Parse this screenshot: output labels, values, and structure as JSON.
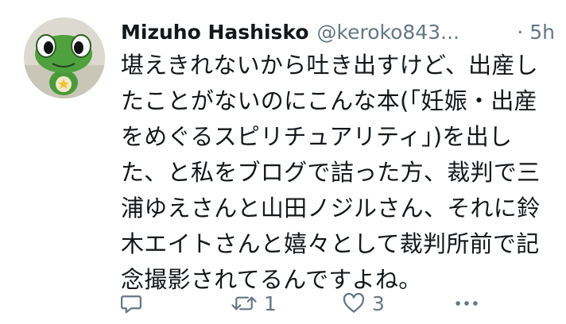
{
  "tweet": {
    "display_name": "Mizuho Hashisko",
    "handle": "@keroko843...",
    "timestamp": "· 5h",
    "text_lines": [
      "堪えきれないから吐き出すけど、出産し",
      "たことがないのにこんな本(「妊娠・出産",
      "をめぐるスピリチュアリティ」)を出し",
      "た、と私をブログで詰った方、裁判で三",
      "浦ゆえさんと山田ノジルさん、それに鈴",
      "木エイトさんと嬉々として裁判所前で記",
      "念撮影されてるんですよね。"
    ],
    "avatar_icon": "frog-character-avatar"
  },
  "actions": {
    "reply": {
      "icon": "reply-icon",
      "count": ""
    },
    "retweet": {
      "icon": "retweet-icon",
      "count": "1"
    },
    "like": {
      "icon": "heart-icon",
      "count": "3"
    },
    "more": {
      "icon": "more-icon"
    }
  },
  "colors": {
    "text": "#14171a",
    "secondary": "#657786",
    "background": "#ffffff"
  }
}
